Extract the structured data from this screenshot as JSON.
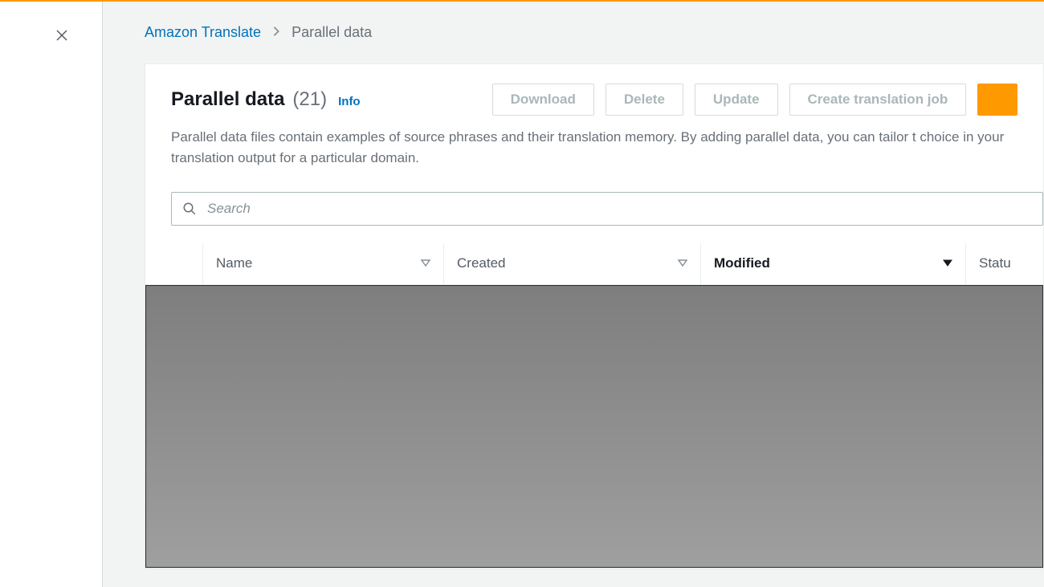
{
  "breadcrumb": {
    "root": "Amazon Translate",
    "current": "Parallel data"
  },
  "page": {
    "title": "Parallel data",
    "count": "(21)",
    "info_label": "Info",
    "description": "Parallel data files contain examples of source phrases and their translation memory. By adding parallel data, you can tailor t choice in your translation output for a particular domain."
  },
  "actions": {
    "download": "Download",
    "delete": "Delete",
    "update": "Update",
    "create_job": "Create translation job"
  },
  "search": {
    "placeholder": "Search"
  },
  "table": {
    "columns": {
      "name": "Name",
      "created": "Created",
      "modified": "Modified",
      "status": "Statu"
    }
  }
}
